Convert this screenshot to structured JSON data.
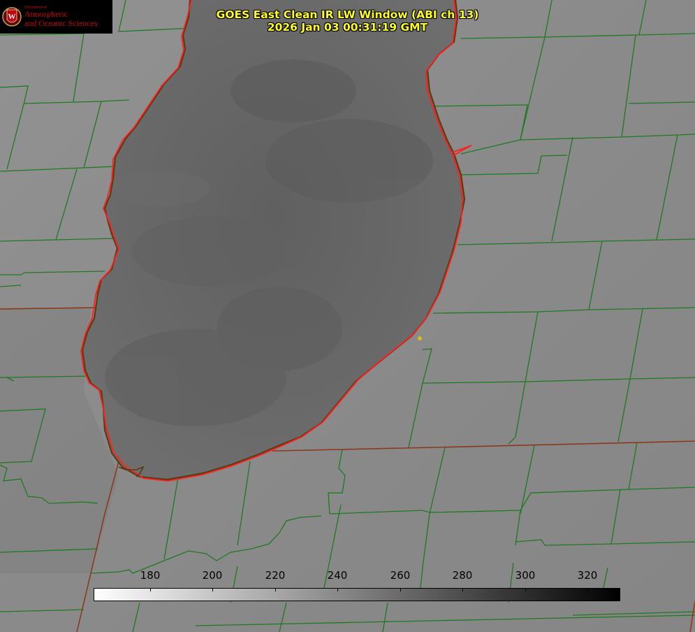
{
  "header": {
    "title_line1": "GOES East Clean IR LW Window (ABI ch 13)",
    "title_line2": "2026 Jan 03 00:31:19 GMT"
  },
  "logo": {
    "dept_small": "Department of",
    "line1": "Atmospheric",
    "line2": "and Oceanic Sciences",
    "emblem": "uw-crest-icon"
  },
  "colorbar": {
    "min": 162,
    "max": 330,
    "ticks": [
      "180",
      "200",
      "220",
      "240",
      "260",
      "280",
      "300",
      "320"
    ],
    "colormap": "white-to-black",
    "low_color": "#ffffff",
    "high_color": "#000000"
  },
  "colors": {
    "land_background": "#8c8c8c",
    "lake_cloud": "#6a6a6a",
    "county_lines": "#1e7a1e",
    "state_lines": "#8a3a1a",
    "shoreline_highlight": "#ff2020",
    "title_text": "#ffff22",
    "marker": "#d4c010"
  },
  "map": {
    "feature": "lake-michigan-shoreline",
    "marker_icon": "station-dot-icon"
  }
}
